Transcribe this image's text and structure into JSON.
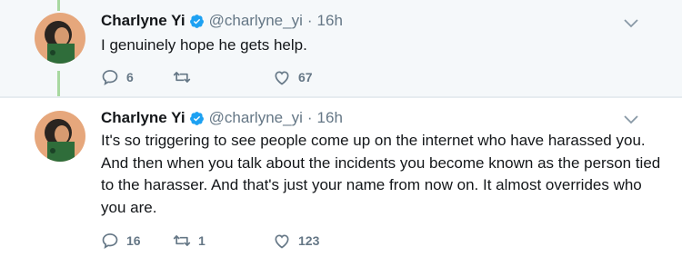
{
  "tweets": [
    {
      "author": {
        "name": "Charlyne Yi",
        "handle": "@charlyne_yi",
        "verified": true
      },
      "time": "16h",
      "separator": "·",
      "text": "I genuinely hope he gets help.",
      "actions": {
        "replies": "6",
        "retweets": "",
        "likes": "67"
      }
    },
    {
      "author": {
        "name": "Charlyne Yi",
        "handle": "@charlyne_yi",
        "verified": true
      },
      "time": "16h",
      "separator": "·",
      "text": "It's so triggering to see people come up on the internet who have harassed you. And then when you talk about the incidents you become known as the person tied to the harasser. And that's just your name from now on. It almost overrides who you are.",
      "actions": {
        "replies": "16",
        "retweets": "1",
        "likes": "123"
      }
    }
  ],
  "colors": {
    "verified": "#1da1f2",
    "muted": "#657786",
    "thread_line": "#a8d8a0",
    "highlight_bg": "#f5f8fa"
  },
  "icons": [
    "verified-badge-icon",
    "caret-down-icon",
    "reply-icon",
    "retweet-icon",
    "like-icon"
  ]
}
